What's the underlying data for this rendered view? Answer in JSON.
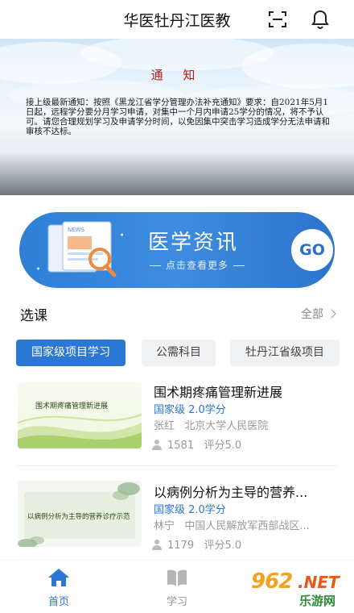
{
  "header": {
    "title": "华医牡丹江医教",
    "scan_icon": "scan-icon",
    "bell_icon": "bell-icon"
  },
  "banner": {
    "notice_title": "通 知",
    "notice_text": "接上级最新通知：按照《黑龙江省学分管理办法补充通知》要求：自2021年5月1日起，远程学分要分月学习申请，对集中一个月内申请25学分的情况，将不予认可。请您合理规划学习及申请学分时间，以免因集中突击学习造成学分无法申请和审核不达标。"
  },
  "news_card": {
    "title": "医学资讯",
    "subtitle": "点击查看更多",
    "go_label": "GO",
    "illustration_label": "NEWS"
  },
  "section": {
    "title": "选课",
    "more_label": "全部"
  },
  "tabs": [
    {
      "label": "国家级项目学习",
      "active": true
    },
    {
      "label": "公需科目",
      "active": false
    },
    {
      "label": "牡丹江省级项目",
      "active": false
    }
  ],
  "courses": [
    {
      "title": "围术期疼痛管理新进展",
      "thumb_text": "围术期疼痛管理新进展",
      "level": "国家级 2.0学分",
      "teacher": "张红",
      "hospital": "北京大学人民医院",
      "views": "1581",
      "rating": "评分5.0"
    },
    {
      "title": "以病例分析为主导的营养...",
      "thumb_text": "以病例分析为主导的营养诊疗示范",
      "level": "国家级 2.0学分",
      "teacher": "林宁",
      "hospital": "中国人民解放军西部战区...",
      "views": "1179",
      "rating": "评分5.0"
    }
  ],
  "bottom_nav": {
    "home_label": "首页",
    "study_label": "学习"
  },
  "watermark": {
    "num": "962",
    "net": ".NET",
    "cn": "乐游网"
  },
  "colors": {
    "accent": "#2a77d4",
    "notice_red": "#b51a12",
    "muted": "#999999"
  }
}
